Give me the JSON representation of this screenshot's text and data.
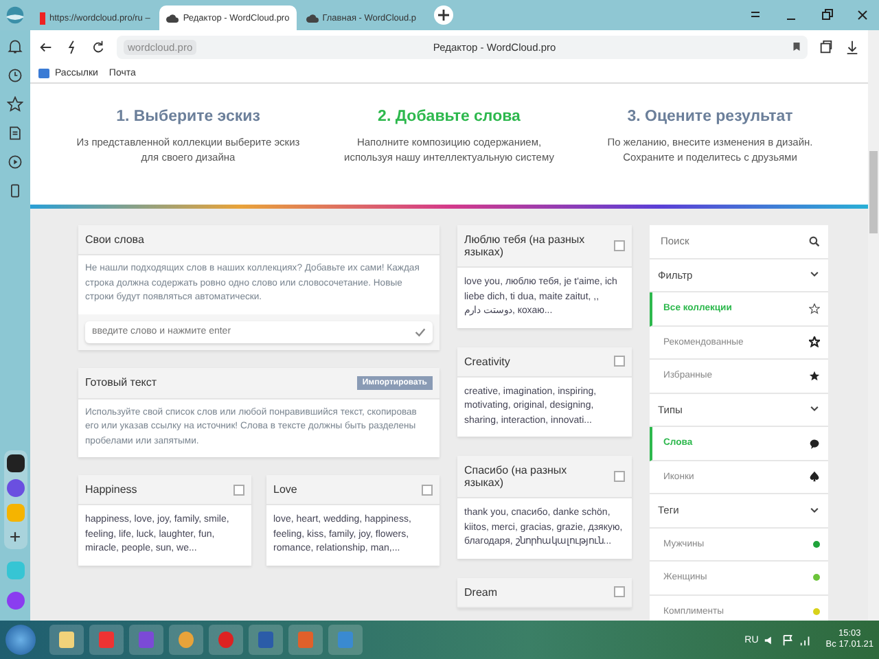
{
  "browser": {
    "tabs": [
      {
        "label": "https://wordcloud.pro/ru –",
        "selected": false
      },
      {
        "label": "Редактор - WordCloud.pro",
        "selected": true
      },
      {
        "label": "Главная - WordCloud.p",
        "selected": false
      }
    ],
    "address": "wordcloud.pro",
    "page_title": "Редактор - WordCloud.pro",
    "bookmarks": [
      "Рассылки",
      "Почта"
    ]
  },
  "steps": [
    {
      "title": "1. Выберите эскиз",
      "text": "Из представленной коллекции выберите эскиз для своего дизайна",
      "selected": false
    },
    {
      "title": "2. Добавьте слова",
      "text": "Наполните композицию содержанием, используя нашу интеллектуальную систему",
      "selected": true
    },
    {
      "title": "3. Оцените результат",
      "text": "По желанию, внесите изменения в дизайн. Сохраните и поделитесь с друзьями",
      "selected": false
    }
  ],
  "own_words": {
    "title": "Свои слова",
    "text": "Не нашли подходящих слов в наших коллекциях? Добавьте их сами! Каждая строка должна содержать ровно одно слово или словосочетание. Новые строки будут появляться автоматически.",
    "placeholder": "введите слово и нажмите enter"
  },
  "ready_text": {
    "title": "Готовый текст",
    "button": "Импортировать",
    "text": "Используйте свой список слов или любой понравившийся текст, скопировав его или указав ссылку на источник! Слова в тексте должны быть разделены пробелами или запятыми."
  },
  "collections_left": [
    {
      "title": "Happiness",
      "words": "happiness, love, joy, family, smile, feeling, life, luck, laughter, fun, miracle, people, sun, we...",
      "checked": false
    },
    {
      "title": "Love",
      "words": "love, heart, wedding, happiness, feeling, kiss, family, joy, flowers, romance, relationship, man,...",
      "checked": false
    }
  ],
  "collections_middle": [
    {
      "title": "Люблю тебя (на разных языках)",
      "words": "love you, люблю тебя, je t'aime, ich liebe dich, ti dua, maite zaitut, ,, دوستت دارم, кохаю...",
      "checked": false
    },
    {
      "title": "Creativity",
      "words": "creative, imagination, inspiring, motivating, original, designing, sharing, interaction, innovati...",
      "checked": false
    },
    {
      "title": "Спасибо (на разных языках)",
      "words": "thank you, спасибо, danke schön, kiitos, merci, gracias, grazie, дзякую, благодаря, շնորհակալություն...",
      "checked": false
    },
    {
      "title": "Dream",
      "checked": false
    }
  ],
  "filter_panel": {
    "search_placeholder": "Поиск",
    "sections": [
      {
        "title": "Фильтр",
        "expanded": true,
        "items": [
          {
            "label": "Все коллекции",
            "selected": true
          },
          {
            "label": "Рекомендованные",
            "selected": false
          },
          {
            "label": "Избранные",
            "selected": false
          }
        ]
      },
      {
        "title": "Типы",
        "expanded": true,
        "items": [
          {
            "label": "Слова",
            "selected": true
          },
          {
            "label": "Иконки",
            "selected": false
          }
        ]
      },
      {
        "title": "Теги",
        "expanded": true,
        "items": [
          {
            "label": "Мужчины",
            "color": "#1fa33a"
          },
          {
            "label": "Женщины",
            "color": "#6cc43a"
          },
          {
            "label": "Комплименты",
            "color": "#d8d21a"
          }
        ]
      }
    ]
  },
  "taskbar": {
    "language": "RU",
    "time": "15:03",
    "date": "Вс 17.01.21"
  }
}
